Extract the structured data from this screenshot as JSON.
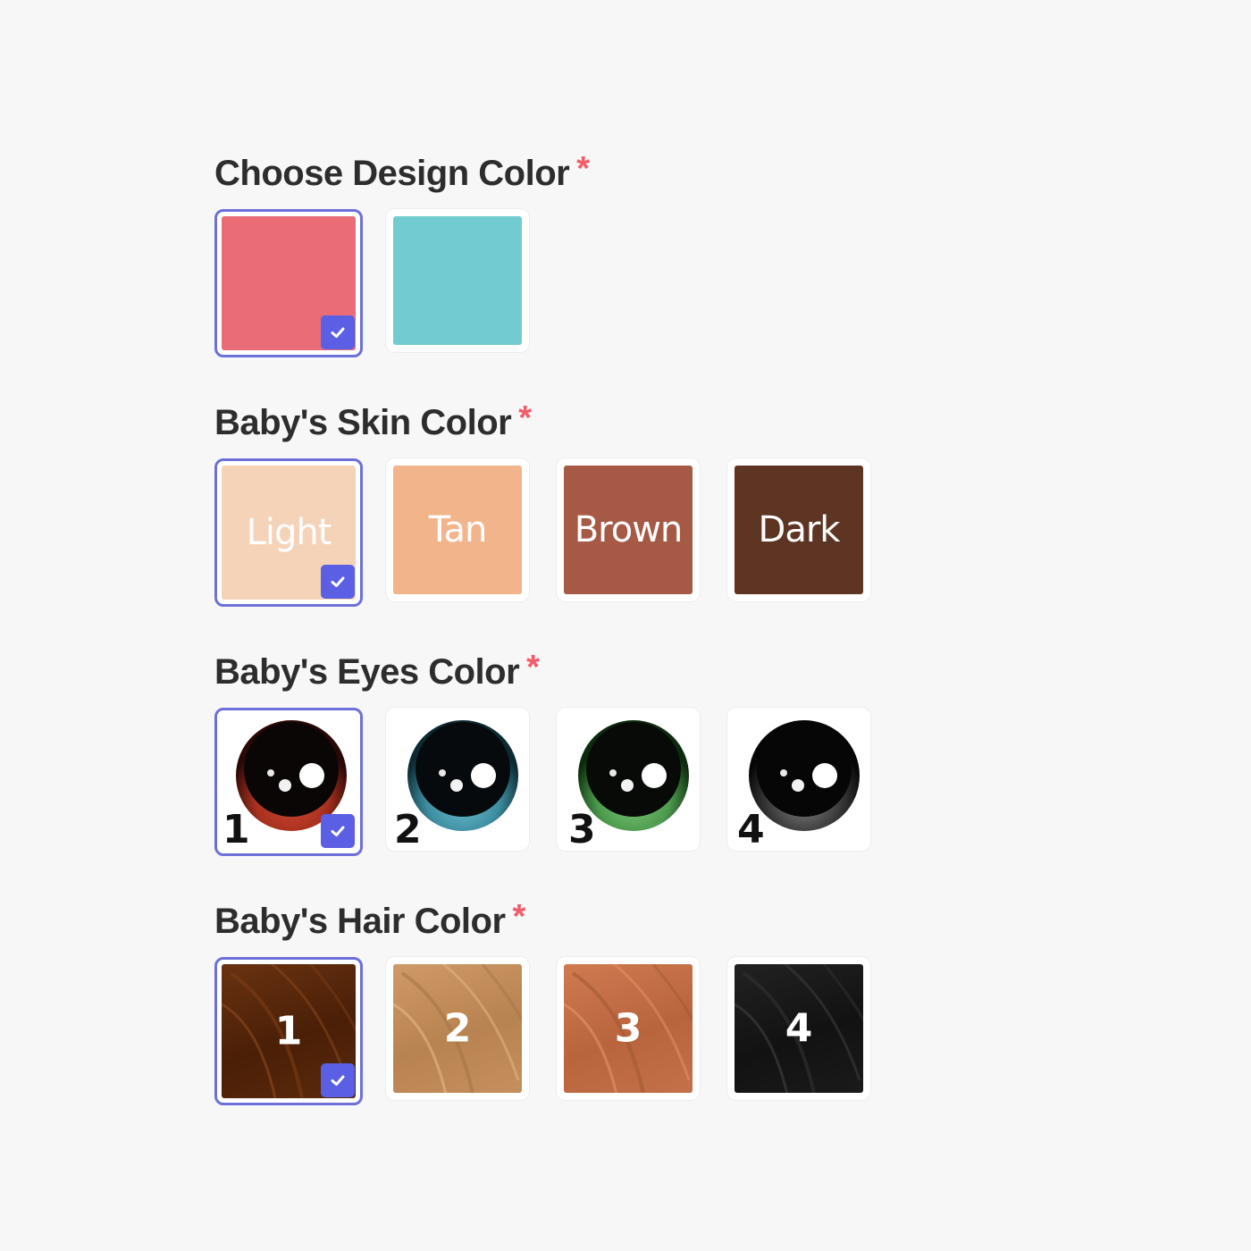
{
  "design_color": {
    "title": "Choose Design Color",
    "required_mark": "*",
    "options": [
      {
        "color": "#e96c77",
        "selected": true
      },
      {
        "color": "#73cbd2",
        "selected": false
      }
    ]
  },
  "skin_color": {
    "title": "Baby's Skin Color",
    "required_mark": "*",
    "options": [
      {
        "label": "Light",
        "color": "#f5d3b8",
        "selected": true
      },
      {
        "label": "Tan",
        "color": "#f2b48a",
        "selected": false
      },
      {
        "label": "Brown",
        "color": "#a65a46",
        "selected": false
      },
      {
        "label": "Dark",
        "color": "#5e3422",
        "selected": false
      }
    ]
  },
  "eyes_color": {
    "title": "Baby's Eyes Color",
    "required_mark": "*",
    "options": [
      {
        "label": "1",
        "iris_color": "#a8301f",
        "selected": true
      },
      {
        "label": "2",
        "iris_color": "#3d8ea0",
        "selected": false
      },
      {
        "label": "3",
        "iris_color": "#4c9a4c",
        "selected": false
      },
      {
        "label": "4",
        "iris_color": "#5a5a5a",
        "selected": false
      }
    ]
  },
  "hair_color": {
    "title": "Baby's Hair Color",
    "required_mark": "*",
    "options": [
      {
        "label": "1",
        "color": "#5b2a0c",
        "selected": true
      },
      {
        "label": "2",
        "color": "#c6905e",
        "selected": false
      },
      {
        "label": "3",
        "color": "#c4704a",
        "selected": false
      },
      {
        "label": "4",
        "color": "#161616",
        "selected": false
      }
    ]
  },
  "selected_mark_color": "#5b5fe4",
  "selected_border_color": "#6c70d8",
  "icons": {
    "selected": "check-icon"
  }
}
